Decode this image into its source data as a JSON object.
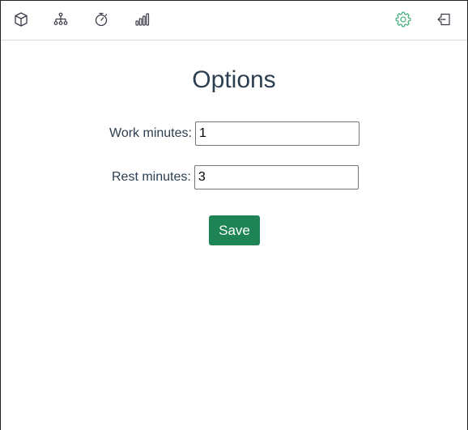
{
  "nav": {
    "items": [
      {
        "icon": "cube-icon",
        "active": false
      },
      {
        "icon": "sitemap-icon",
        "active": false
      },
      {
        "icon": "stopwatch-icon",
        "active": false
      },
      {
        "icon": "bar-chart-icon",
        "active": false
      },
      {
        "icon": "gear-icon",
        "active": true
      },
      {
        "icon": "logout-icon",
        "active": false
      }
    ],
    "active_color": "#3fae7a",
    "icon_color": "#3a3a4a"
  },
  "page": {
    "title": "Options"
  },
  "form": {
    "work_label": "Work minutes:",
    "work_value": "1",
    "rest_label": "Rest minutes:",
    "rest_value": "3",
    "save_label": "Save"
  },
  "colors": {
    "save_button": "#1e8456",
    "text": "#2c3e50"
  }
}
